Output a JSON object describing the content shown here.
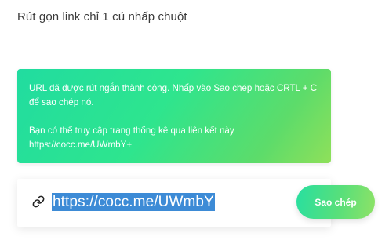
{
  "page": {
    "title": "Rút gọn link chỉ 1 cú nhấp chuột"
  },
  "notice": {
    "line1": "URL đã được rút ngắn thành công. Nhấp vào Sao chép hoặc CRTL + C để sao chép nó.",
    "line2": "Bạn có thể truy cập trang thống kê qua liên kết này https://cocc.me/UWmbY+",
    "background_colors": [
      "#21dca0",
      "#8fe05a"
    ]
  },
  "result": {
    "icon": "link-icon",
    "short_url": "https://cocc.me/UWmbY",
    "selection_color": "#3d8bd6"
  },
  "copy_button": {
    "label": "Sao chép"
  }
}
